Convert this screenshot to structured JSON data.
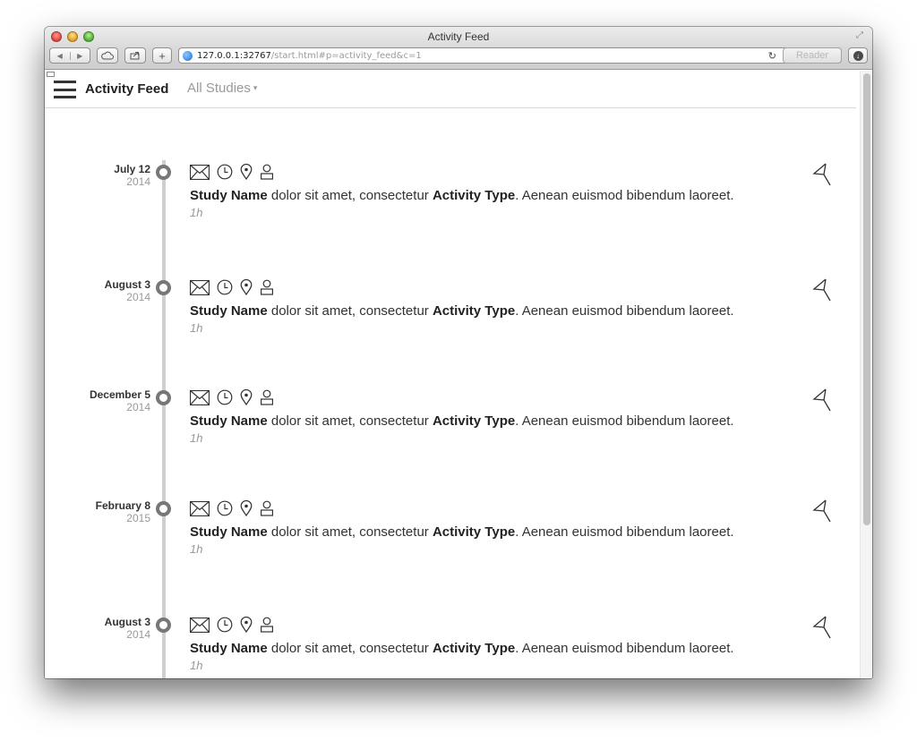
{
  "browser": {
    "window_title": "Activity Feed",
    "url_host": "127.0.0.1:32767",
    "url_path": "/start.html#p=activity_feed&c=1",
    "reader_label": "Reader",
    "reload_glyph": "↻",
    "new_tab_glyph": "+"
  },
  "header": {
    "title": "Activity Feed",
    "filter_label": "All Studies",
    "filter_caret": "▾"
  },
  "feed": [
    {
      "day": "July 12",
      "year": "2014",
      "study": "Study Name",
      "text_mid": " dolor sit amet, consectetur ",
      "activity": "Activity Type",
      "text_end": ". Aenean euismod bibendum laoreet.",
      "elapsed": "1h"
    },
    {
      "day": "August 3",
      "year": "2014",
      "study": "Study Name",
      "text_mid": " dolor sit amet, consectetur ",
      "activity": "Activity Type",
      "text_end": ". Aenean euismod bibendum laoreet.",
      "elapsed": "1h"
    },
    {
      "day": "December 5",
      "year": "2014",
      "study": "Study Name",
      "text_mid": " dolor sit amet, consectetur ",
      "activity": "Activity Type",
      "text_end": ". Aenean euismod bibendum laoreet.",
      "elapsed": "1h"
    },
    {
      "day": "February 8",
      "year": "2015",
      "study": "Study Name",
      "text_mid": " dolor sit amet, consectetur ",
      "activity": "Activity Type",
      "text_end": ". Aenean euismod bibendum laoreet.",
      "elapsed": "1h"
    },
    {
      "day": "August 3",
      "year": "2014",
      "study": "Study Name",
      "text_mid": " dolor sit amet, consectetur ",
      "activity": "Activity Type",
      "text_end": ". Aenean euismod bibendum laoreet.",
      "elapsed": "1h"
    }
  ],
  "icons": [
    "envelope-icon",
    "clock-icon",
    "map-pin-icon",
    "person-icon",
    "flag-icon"
  ],
  "colors": {
    "timeline": "#cfcfcf",
    "node": "#777777",
    "muted": "#999999"
  }
}
